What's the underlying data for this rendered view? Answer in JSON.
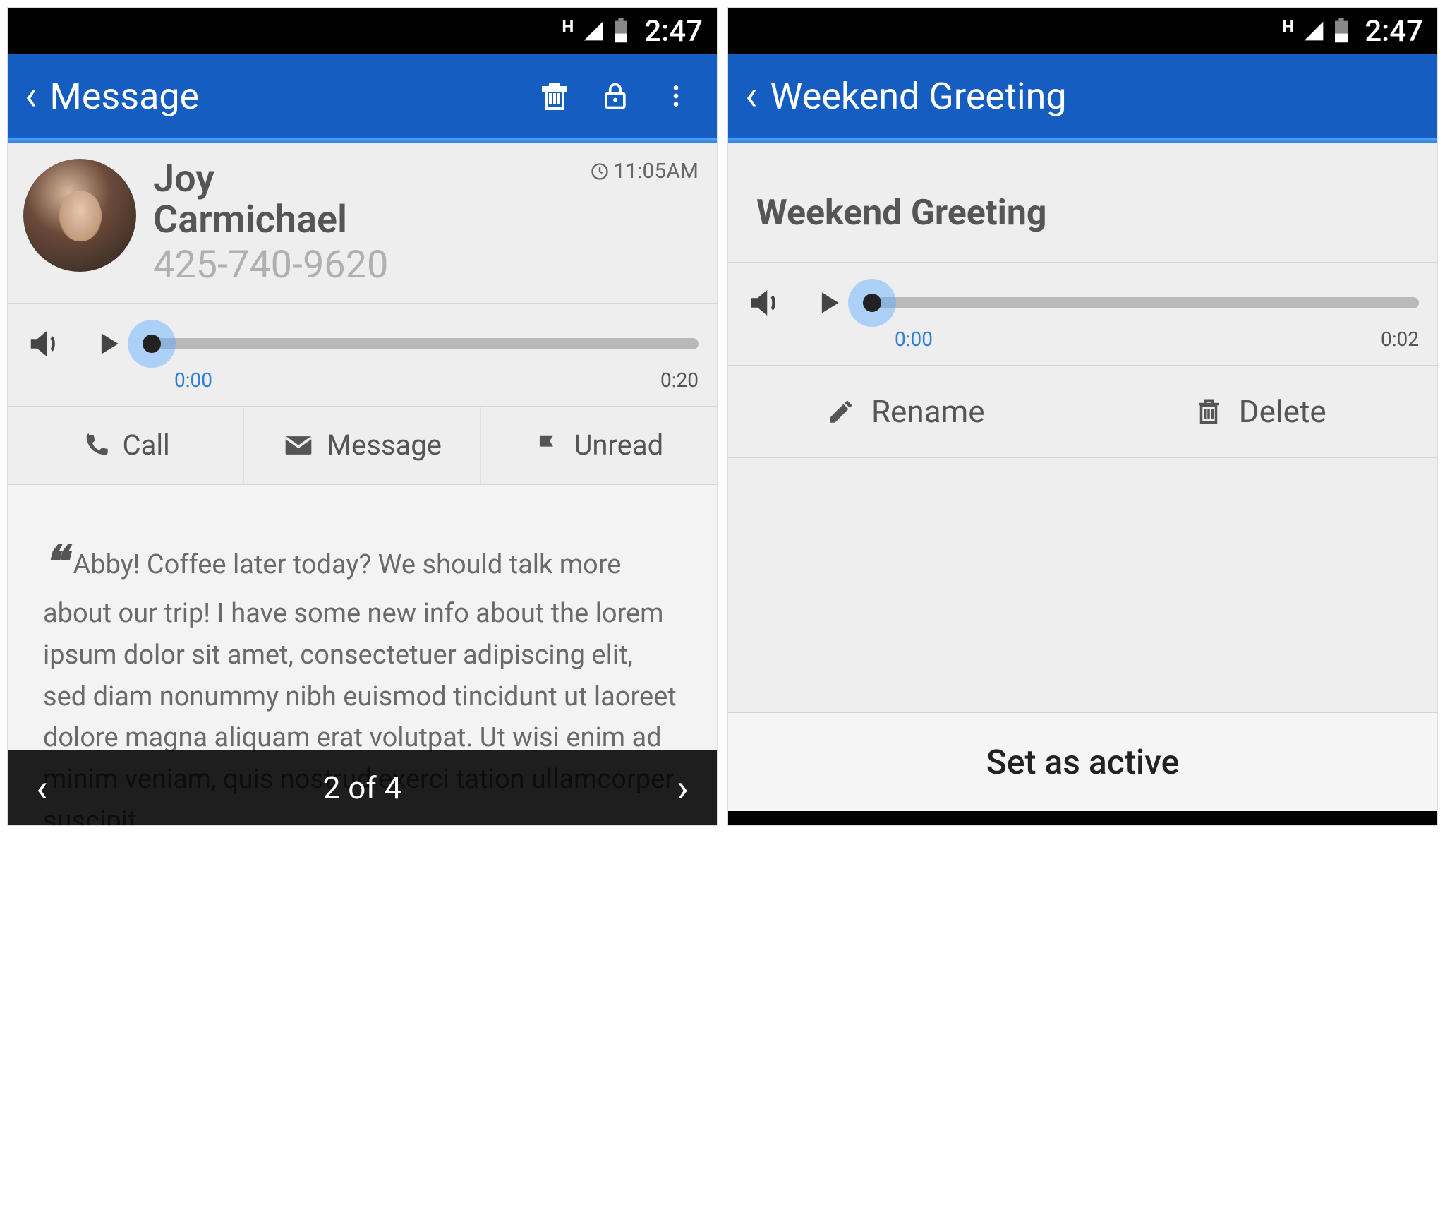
{
  "statusbar": {
    "time": "2:47",
    "network_label": "H"
  },
  "left": {
    "appbar": {
      "title": "Message"
    },
    "contact": {
      "name_first": "Joy",
      "name_last": "Carmichael",
      "phone": "425-740-9620",
      "time": "11:05AM"
    },
    "player": {
      "current": "0:00",
      "duration": "0:20"
    },
    "actions": {
      "call": "Call",
      "message": "Message",
      "unread": "Unread"
    },
    "transcript": "Abby! Coffee later today? We should talk more about our trip! I have some new info about the lorem ipsum dolor sit amet, consectetuer adipiscing elit, sed diam nonummy nibh euismod tincidunt ut laoreet dolore magna aliquam erat volutpat. Ut wisi enim ad minim veniam, quis nostrud exerci tation ullamcorper suscipit",
    "pager": {
      "label": "2 of 4"
    }
  },
  "right": {
    "appbar": {
      "title": "Weekend Greeting"
    },
    "greeting_title": "Weekend Greeting",
    "player": {
      "current": "0:00",
      "duration": "0:02"
    },
    "actions": {
      "rename": "Rename",
      "delete": "Delete"
    },
    "set_active": "Set as active"
  }
}
